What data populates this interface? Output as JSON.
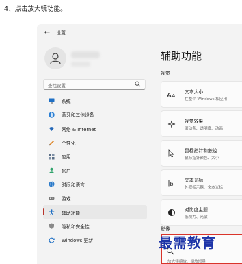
{
  "caption": "4、点击放大镜功能。",
  "window": {
    "app_title": "设置",
    "back_glyph": "←",
    "search_placeholder": "查找设置"
  },
  "sidebar": {
    "items": [
      {
        "label": "系统",
        "icon": "monitor-icon"
      },
      {
        "label": "蓝牙和其他设备",
        "icon": "bluetooth-icon"
      },
      {
        "label": "网络 & Internet",
        "icon": "wifi-icon"
      },
      {
        "label": "个性化",
        "icon": "pen-icon"
      },
      {
        "label": "应用",
        "icon": "apps-icon"
      },
      {
        "label": "帐户",
        "icon": "person-icon"
      },
      {
        "label": "时间和语言",
        "icon": "globe-icon"
      },
      {
        "label": "游戏",
        "icon": "gamepad-icon"
      },
      {
        "label": "辅助功能",
        "icon": "accessibility-icon",
        "active": true
      },
      {
        "label": "隐私和安全性",
        "icon": "shield-icon"
      },
      {
        "label": "Windows 更新",
        "icon": "update-icon"
      }
    ]
  },
  "main": {
    "title": "辅助功能",
    "section_vision": "视觉",
    "section_image": "影像",
    "cards": [
      {
        "title": "文本大小",
        "subtitle": "在整个 Windows 和应用",
        "icon": "text-size-icon"
      },
      {
        "title": "视觉效果",
        "subtitle": "滚动条、透明度、动画",
        "icon": "sparkle-icon"
      },
      {
        "title": "鼠标指针和触控",
        "subtitle": "鼠标指针颜色、大小",
        "icon": "pointer-icon"
      },
      {
        "title": "文本光标",
        "subtitle": "外观指示器、文本光标",
        "icon": "text-cursor-icon"
      },
      {
        "title": "对比度主题",
        "subtitle": "低视力、光敏",
        "icon": "contrast-icon"
      }
    ],
    "magnifier": {
      "subtitle": "放大镜缩放、缩放增量",
      "icon": "magnifier-icon"
    }
  },
  "watermark": "最需教育",
  "colors": {
    "highlight_border": "#d9342b",
    "active_indicator": "#b8342c",
    "watermark": "#1d34a8",
    "accent": "#0067c0"
  }
}
